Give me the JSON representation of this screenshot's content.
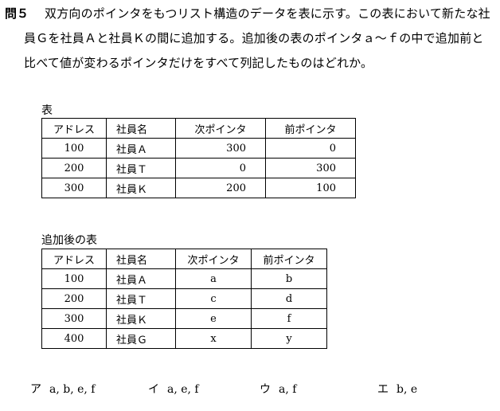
{
  "question": {
    "number": "問５",
    "line1": "双方向のポインタをもつリスト構造のデータを表に示す。この表において新たな社",
    "line2": "員Ｇを社員Ａと社員Ｋの間に追加する。追加後の表のポインタａ～ｆの中で追加前と",
    "line3": "比べて値が変わるポインタだけをすべて列記したものはどれか。"
  },
  "table_before": {
    "label": "表",
    "headers": [
      "アドレス",
      "社員名",
      "次ポインタ",
      "前ポインタ"
    ],
    "rows": [
      [
        "100",
        "社員Ａ",
        "300",
        "0"
      ],
      [
        "200",
        "社員Ｔ",
        "0",
        "300"
      ],
      [
        "300",
        "社員Ｋ",
        "200",
        "100"
      ]
    ]
  },
  "table_after": {
    "label": "追加後の表",
    "headers": [
      "アドレス",
      "社員名",
      "次ポインタ",
      "前ポインタ"
    ],
    "rows": [
      [
        "100",
        "社員Ａ",
        "a",
        "b"
      ],
      [
        "200",
        "社員Ｔ",
        "c",
        "d"
      ],
      [
        "300",
        "社員Ｋ",
        "e",
        "f"
      ],
      [
        "400",
        "社員Ｇ",
        "x",
        "y"
      ]
    ]
  },
  "choices": [
    {
      "mark": "ア",
      "text": "a, b, e, f"
    },
    {
      "mark": "イ",
      "text": "a, e, f"
    },
    {
      "mark": "ウ",
      "text": "a, f"
    },
    {
      "mark": "エ",
      "text": "b, e"
    }
  ]
}
